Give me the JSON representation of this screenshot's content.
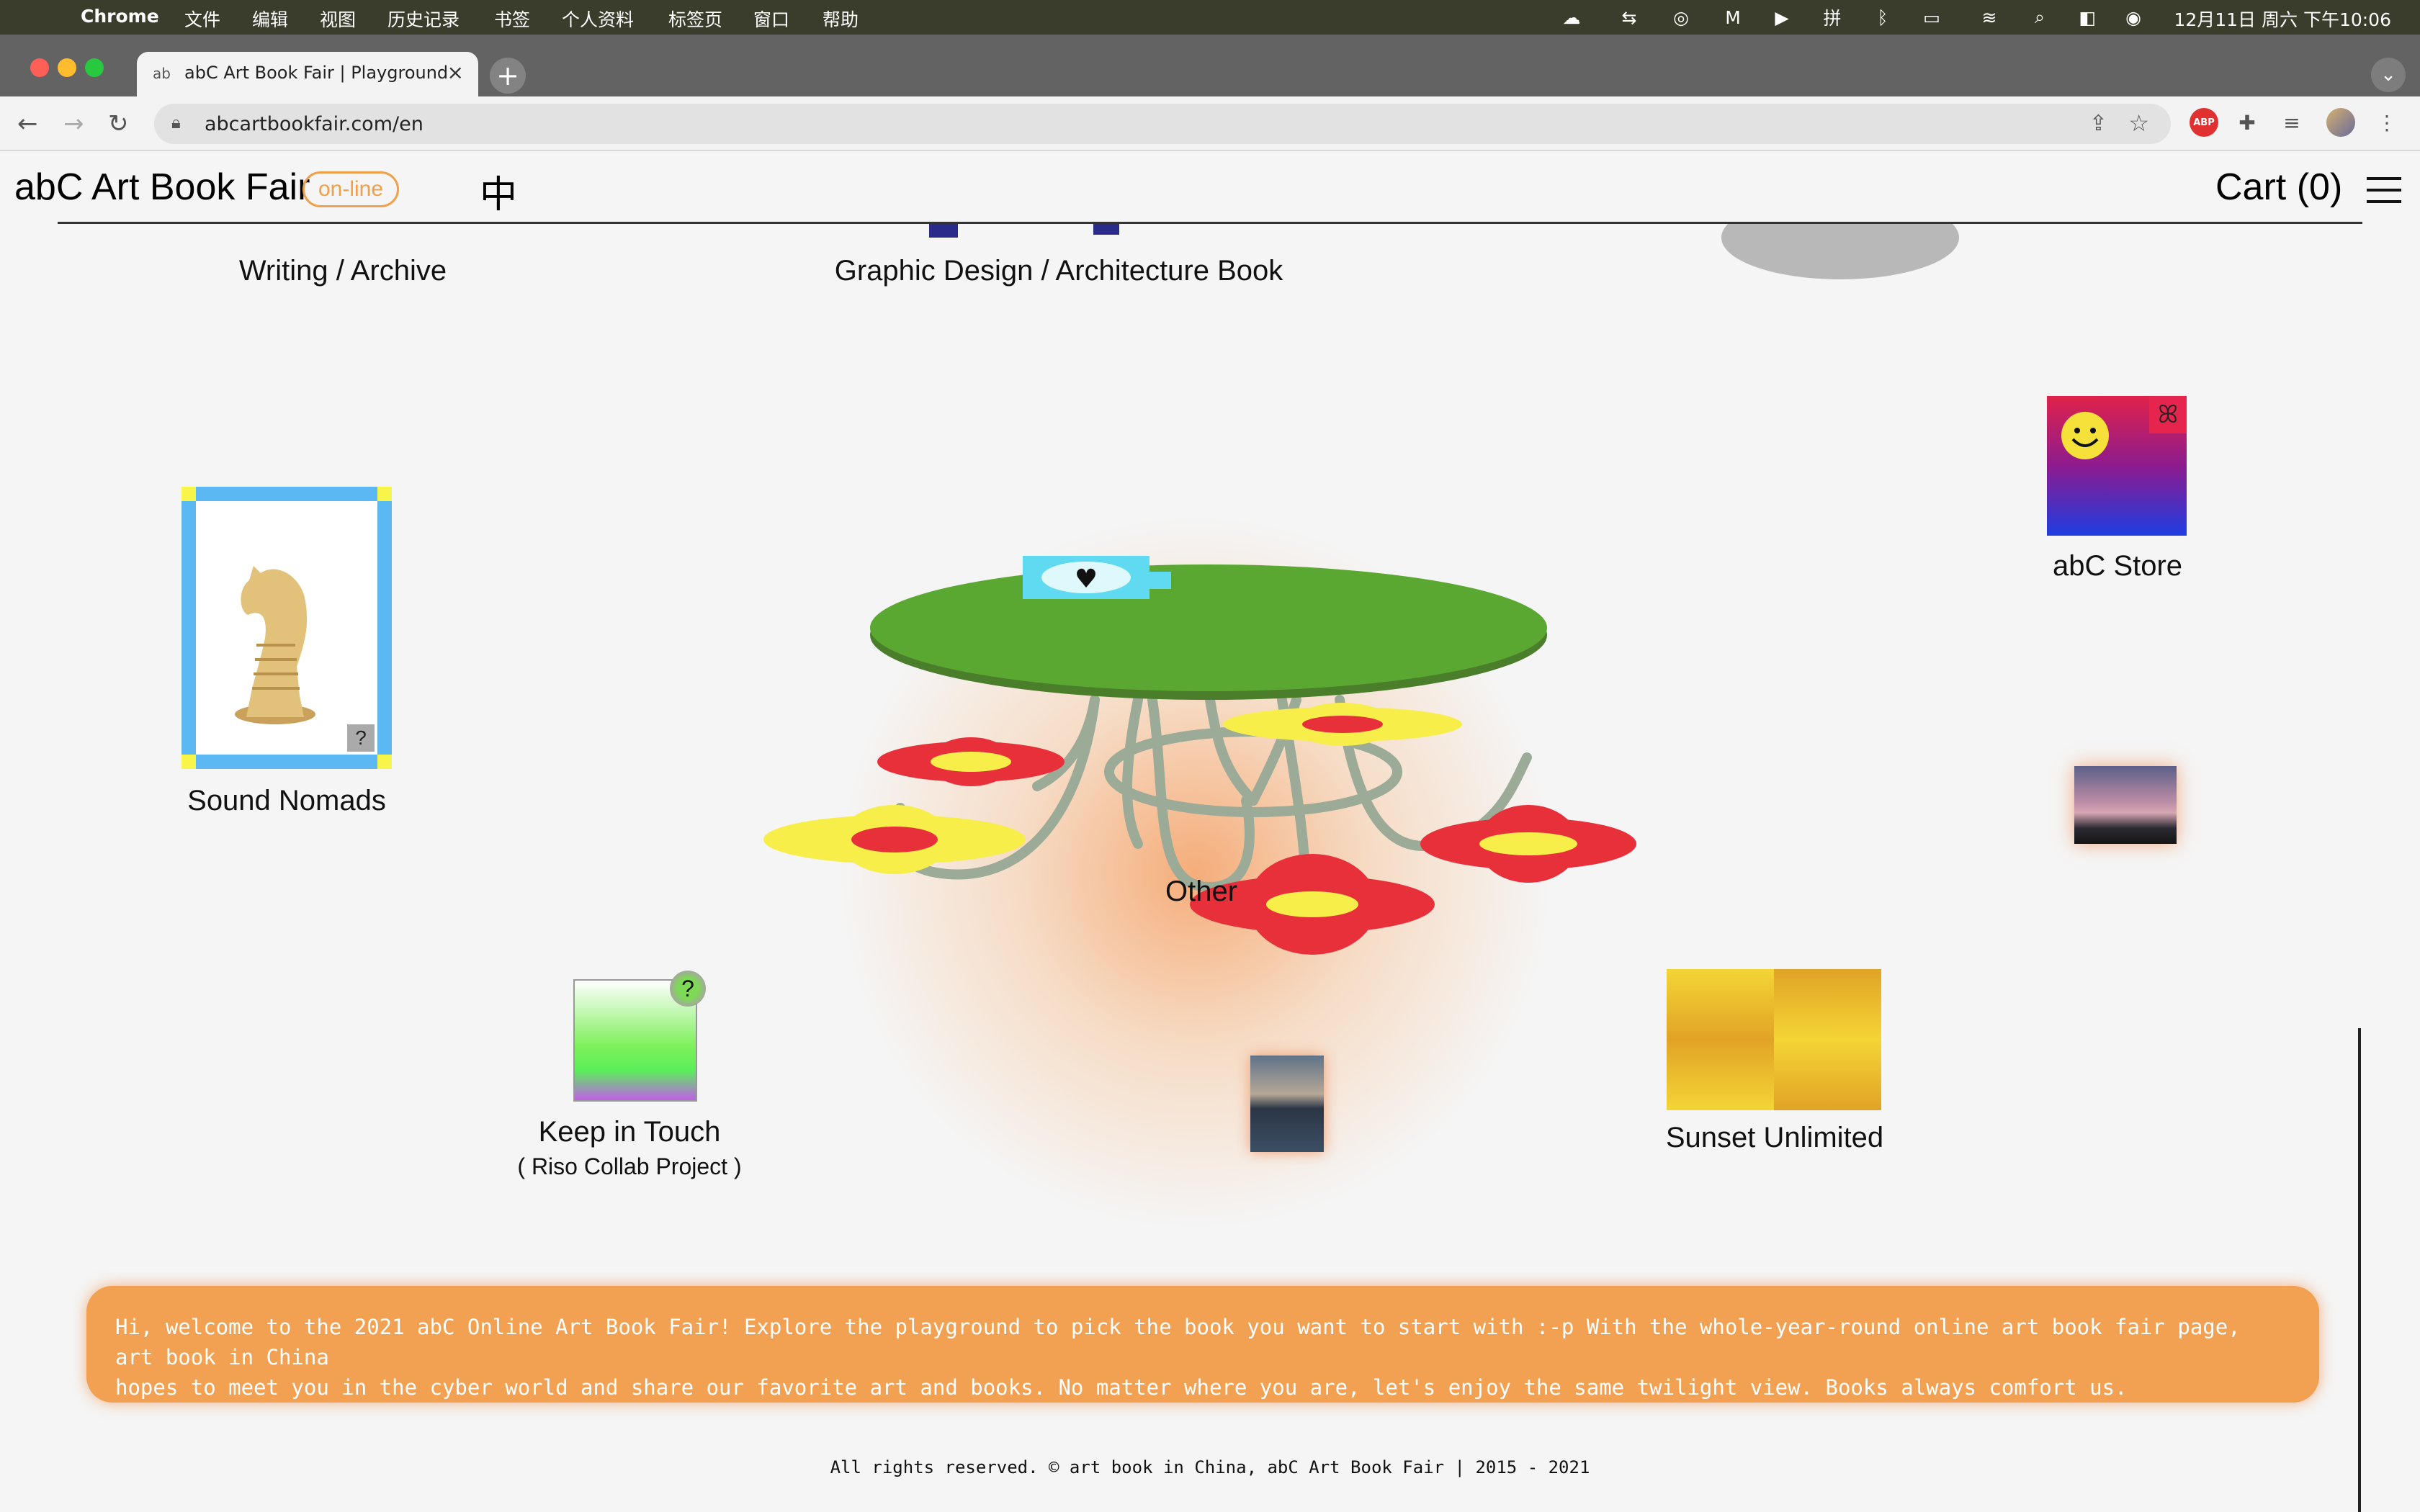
{
  "menubar": {
    "app": "Chrome",
    "items": [
      "文件",
      "编辑",
      "视图",
      "历史记录",
      "书签",
      "个人资料",
      "标签页",
      "窗口",
      "帮助"
    ],
    "clock": "12月11日 周六 下午10:06"
  },
  "browser": {
    "tab_title": "abC Art Book Fair | Playground",
    "url": "abcartbookfair.com/en",
    "extensions": [
      "ABP"
    ]
  },
  "site": {
    "title": "abC Art Book Fair",
    "online_badge": "on-line",
    "lang_toggle": "中",
    "cart_label": "Cart",
    "cart_count": "(0)"
  },
  "playground": {
    "writing": "Writing / Archive",
    "graphic": "Graphic Design / Architecture Book",
    "sound": "Sound Nomads",
    "store": "abC Store",
    "other": "Other",
    "keep": "Keep in Touch",
    "keep_sub": "( Riso Collab Project )",
    "sunset": "Sunset Unlimited",
    "question_mark": "?"
  },
  "welcome": {
    "line1": "Hi, welcome to the 2021 abC Online Art Book Fair! Explore the playground to pick the book you want to start with :-p With the whole-year-round online art book fair page, art book in China",
    "line2": "hopes to meet you in the cyber world and share our favorite art and books. No matter where you are, let's enjoy the same twilight view. Books always comfort us."
  },
  "footer": "All rights reserved. © art book in China, abC Art Book Fair | 2015 - 2021",
  "colors": {
    "accent": "#f2a152",
    "table": "#5aa832",
    "flower_red": "#e8303a",
    "flower_yellow": "#f7ee4a",
    "card_blue": "#5bb8f2"
  }
}
